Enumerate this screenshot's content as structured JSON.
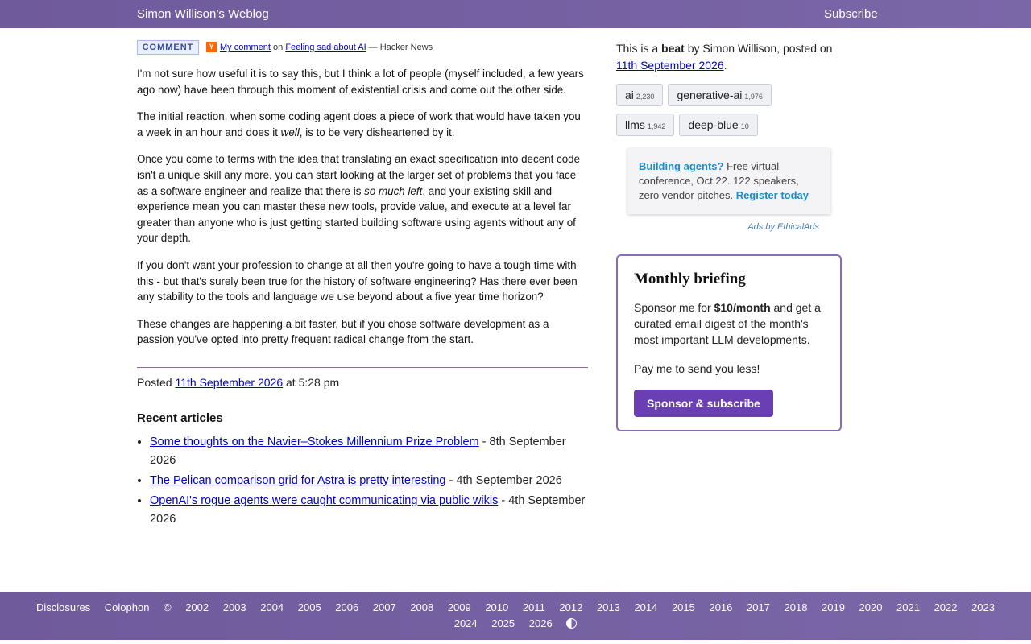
{
  "header": {
    "site_title": "Simon Willison’s Weblog",
    "subscribe": "Subscribe"
  },
  "comment": {
    "badge": "COMMENT",
    "hn_icon": "Y",
    "my_comment": "My comment",
    "on": " on ",
    "article_link": "Feeling sad about AI",
    "source": " — Hacker News",
    "paragraphs": [
      [
        "I'm not sure how useful it is to say this, but I think a lot of people (myself included, a few years ago now) have been through this moment of existential crisis and come out the other side."
      ],
      [
        "The initial reaction, when some coding agent does a piece of work that would have taken you a week in an hour and does it ",
        "well",
        ", is to be very disheartened by it."
      ],
      [
        "Once you come to terms with the idea that translating an exact specification into decent code isn't a unique skill any more, you can start looking at the larger set of problems that you face as a software engineer and realize that there is ",
        "so much left",
        ", and your existing skill and experience mean you can master these new tools, provide value, and execute at a level far greater than anyone who is just getting started building software using agents without any of your depth."
      ],
      [
        "If you don't want your profession to change at all then you're going to have a tough time with this - but that's surely been true for the history of software engineering? Has there ever been any stability to the tools and language we use beyond about a five year time horizon?"
      ],
      [
        "These changes are happening a bit faster, but if you chose software development as a passion you've opted into pretty frequent radical change from the start."
      ]
    ]
  },
  "posted": {
    "prefix": "Posted ",
    "date": "11th September 2026",
    "time": " at 5:28 pm"
  },
  "recent": {
    "heading": "Recent articles",
    "items": [
      {
        "title": "Some thoughts on the Navier–Stokes Millennium Prize Problem",
        "date": " - 8th September 2026"
      },
      {
        "title": "The Pelican comparison grid for Astra is pretty interesting",
        "date": " - 4th September 2026"
      },
      {
        "title": "OpenAI's rogue agents were caught communicating via public wikis",
        "date": " - 4th September 2026"
      }
    ]
  },
  "sidebar": {
    "intro_prefix": "This is a ",
    "intro_type": "beat",
    "intro_middle": " by Simon Willison, posted on ",
    "intro_date": "11th September 2026",
    "intro_end": ".",
    "tags": [
      {
        "name": "ai",
        "count": "2,230"
      },
      {
        "name": "generative-ai",
        "count": "1,976"
      },
      {
        "name": "llms",
        "count": "1,942"
      },
      {
        "name": "deep-blue",
        "count": "10"
      }
    ],
    "ad": {
      "strong": "Building agents?",
      "text": " Free virtual conference, Oct 22. 122 speakers, zero vendor pitches. ",
      "cta": "Register today",
      "credit": "Ads by EthicalAds"
    },
    "briefing": {
      "title": "Monthly briefing",
      "p1_prefix": "Sponsor me for ",
      "p1_price": "$10/month",
      "p1_suffix": " and get a curated email digest of the month's most important LLM developments.",
      "p2": "Pay me to send you less!",
      "button": "Sponsor & subscribe"
    }
  },
  "footer": {
    "row1": [
      "Disclosures",
      "Colophon",
      "©",
      "2002",
      "2003",
      "2004",
      "2005",
      "2006",
      "2007",
      "2008",
      "2009",
      "2010",
      "2011",
      "2012",
      "2013",
      "2014",
      "2015",
      "2016",
      "2017",
      "2018",
      "2019",
      "2020",
      "2021",
      "2022",
      "2023"
    ],
    "row2": [
      "2024",
      "2025",
      "2026"
    ]
  }
}
